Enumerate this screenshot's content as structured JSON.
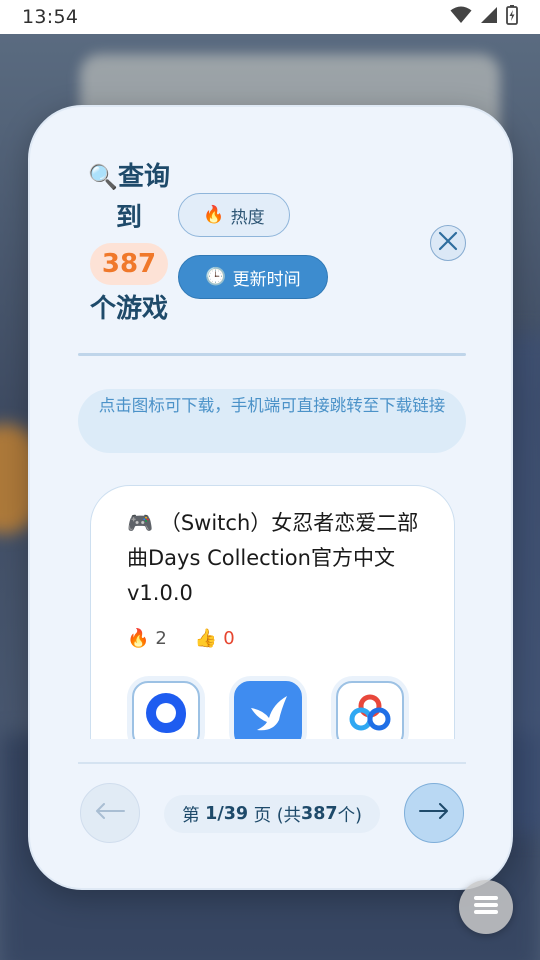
{
  "status_bar": {
    "time": "13:54",
    "icons": [
      "wifi-icon",
      "signal-icon",
      "battery-charging-icon"
    ]
  },
  "header": {
    "search_icon": "🔍",
    "title_line1": "查询",
    "title_line2": "到",
    "count": "387",
    "title_line3": "个游戏"
  },
  "sort": {
    "hot_icon": "🔥",
    "hot_label": "热度",
    "time_icon": "🕒",
    "time_label": "更新时间",
    "active": "time"
  },
  "notice": "点击图标可下载，手机端可直接跳转至下载链接",
  "games": [
    {
      "icon": "🎮",
      "title": "（Switch）女忍者恋爱二部曲Days Collection官方中文v1.0.0",
      "hot_icon": "🔥",
      "hot_count": "2",
      "like_icon": "👍",
      "like_count": "0",
      "downloads": [
        "quark-icon",
        "thunder-icon",
        "baidu-netdisk-icon"
      ]
    }
  ],
  "pagination": {
    "prefix": "第",
    "current": "1/39",
    "middle": "页 (共",
    "total": "387",
    "suffix": "个)"
  },
  "colors": {
    "accent": "#3d8ccf",
    "title": "#1e4a6a",
    "count_text": "#f0782a",
    "count_bg": "#fde2d6",
    "like": "#e6452f"
  }
}
